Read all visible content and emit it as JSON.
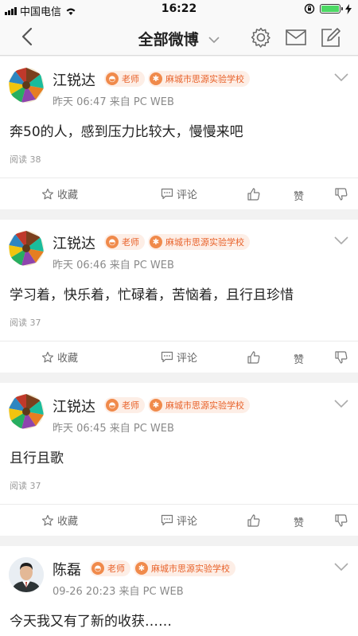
{
  "status_bar": {
    "carrier": "中国电信",
    "time": "16:22"
  },
  "nav": {
    "title": "全部微博"
  },
  "posts": [
    {
      "name": "江锐达",
      "badge_role": "老师",
      "badge_school": "麻城市思源实验学校",
      "meta": "昨天 06:47 来自 PC WEB",
      "content": "奔50的人，感到压力比较大，慢慢来吧",
      "reads": "阅读 38",
      "fav": "收藏",
      "comment": "评论",
      "like": "赞"
    },
    {
      "name": "江锐达",
      "badge_role": "老师",
      "badge_school": "麻城市思源实验学校",
      "meta": "昨天 06:46 来自 PC WEB",
      "content": "学习着，快乐着，忙碌着，苦恼着，且行且珍惜",
      "reads": "阅读 37",
      "fav": "收藏",
      "comment": "评论",
      "like": "赞"
    },
    {
      "name": "江锐达",
      "badge_role": "老师",
      "badge_school": "麻城市思源实验学校",
      "meta": "昨天 06:45 来自 PC WEB",
      "content": "且行且歌",
      "reads": "阅读 37",
      "fav": "收藏",
      "comment": "评论",
      "like": "赞"
    },
    {
      "name": "陈磊",
      "badge_role": "老师",
      "badge_school": "麻城市思源实验学校",
      "meta": "09-26 20:23 来自 PC WEB",
      "content": "今天我又有了新的收获……"
    }
  ],
  "colors": {
    "accent": "#e8622a",
    "badge_bg": "#fdeee6",
    "battery": "#4cd964"
  }
}
